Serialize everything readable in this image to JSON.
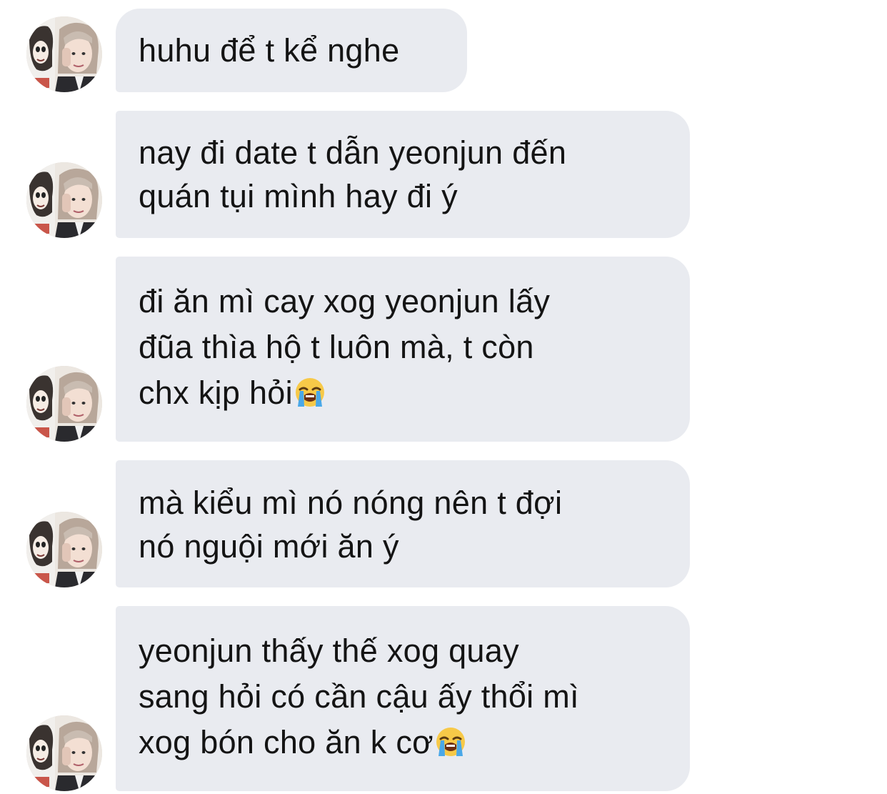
{
  "conversation": {
    "messages": [
      {
        "lines": [
          "huhu để t kể nghe"
        ],
        "emoji": ""
      },
      {
        "lines": [
          "nay đi date t dẫn yeonjun đến",
          "quán tụi mình hay đi ý"
        ],
        "emoji": ""
      },
      {
        "lines": [
          "đi ăn mì cay xog yeonjun lấy",
          "đũa thìa hộ t luôn mà, t còn",
          "chx kịp hỏi"
        ],
        "emoji": "loudly-crying-face-icon"
      },
      {
        "lines": [
          "mà kiểu mì nó nóng nên t đợi",
          "nó nguội mới ăn ý"
        ],
        "emoji": ""
      },
      {
        "lines": [
          "yeonjun thấy thế xog quay",
          "sang hỏi có cần cậu ấy thổi mì",
          "xog bón cho ăn k cơ"
        ],
        "emoji": "loudly-crying-face-icon"
      }
    ]
  },
  "colors": {
    "incoming_bubble": "#e9ebf0",
    "text": "#141414",
    "background": "#ffffff"
  }
}
